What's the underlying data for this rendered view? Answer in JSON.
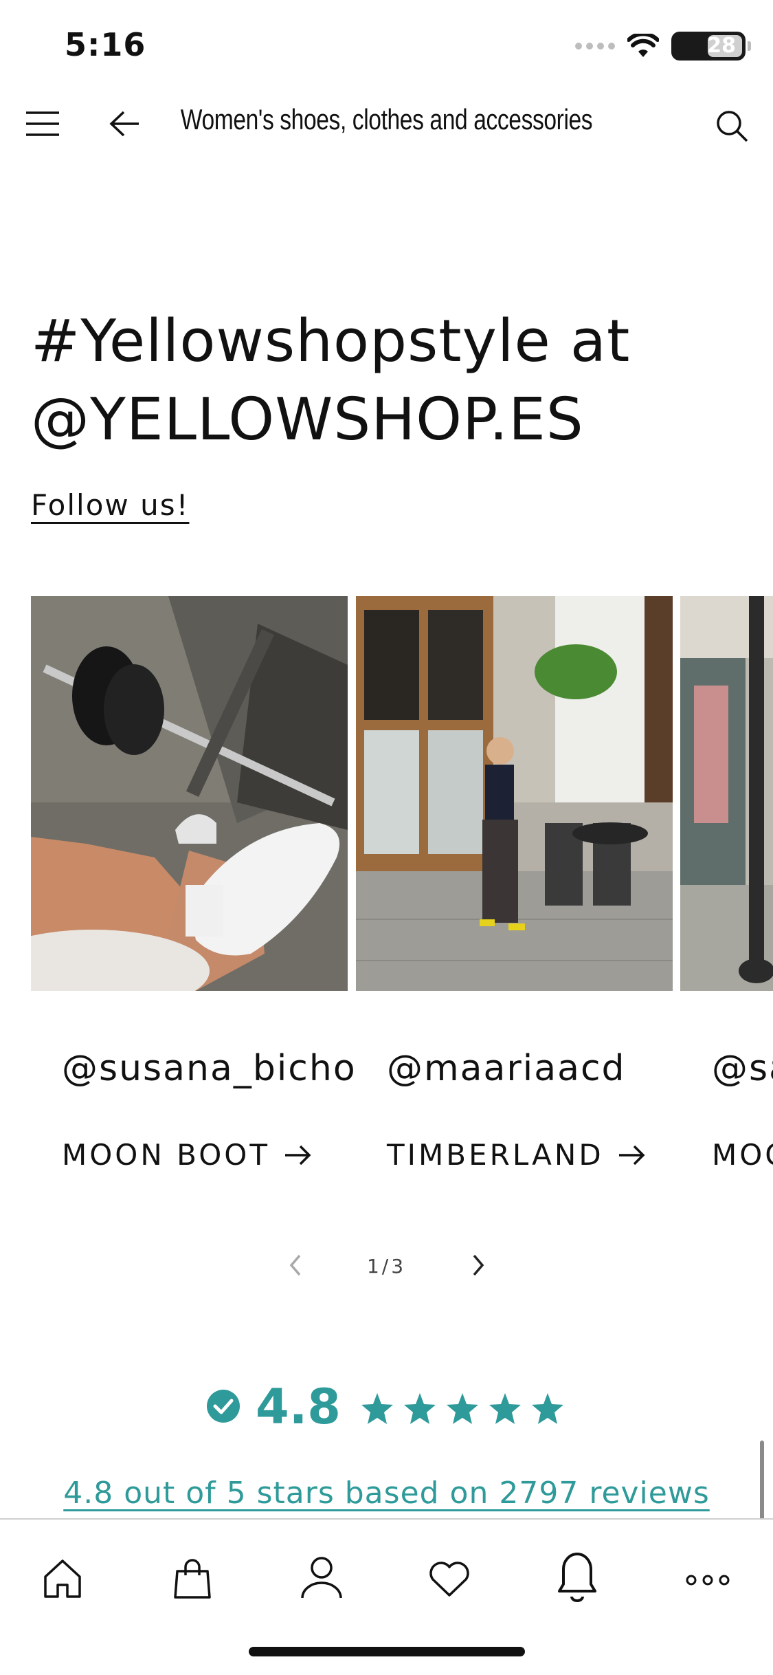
{
  "status_bar": {
    "time": "5:16",
    "battery": "28"
  },
  "header": {
    "title": "Women's shoes, clothes and accessories"
  },
  "section": {
    "heading_line1": "#Yellowshopstyle at",
    "heading_line2": "@YELLOWSHOP.ES",
    "follow_label": "Follow us!"
  },
  "gallery": {
    "cards": [
      {
        "user": "@susana_bicho",
        "brand": "MOON BOOT"
      },
      {
        "user": "@maariaacd",
        "brand": "TIMBERLAND"
      },
      {
        "user": "@sa",
        "brand": "MOO"
      }
    ],
    "pager": "1/3"
  },
  "rating": {
    "value": "4.8",
    "stars": 5,
    "reviews_text": "4.8 out of 5 stars based on 2797 reviews"
  },
  "tabbar": {
    "items": [
      "home-icon",
      "shopping-bag-icon",
      "user-icon",
      "heart-icon",
      "bell-icon",
      "more-icon"
    ]
  },
  "colors": {
    "accent": "#2e9a99",
    "text": "#111111"
  }
}
